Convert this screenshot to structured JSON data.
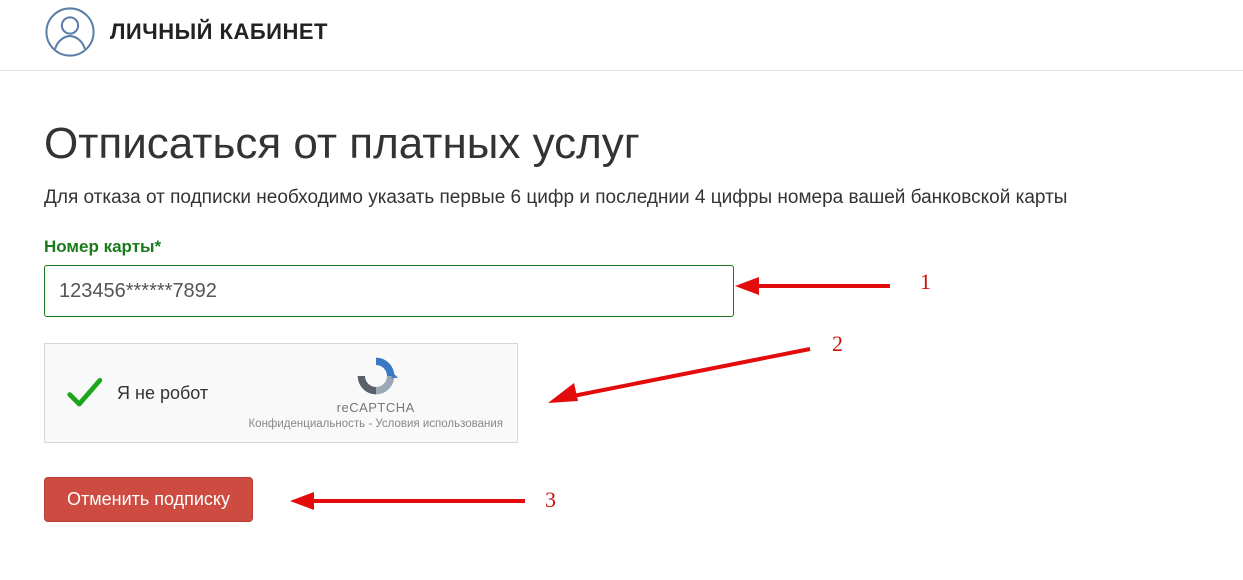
{
  "header": {
    "title": "ЛИЧНЫЙ КАБИНЕТ"
  },
  "page": {
    "heading": "Отписаться от платных услуг",
    "lead": "Для отказа от подписки необходимо указать первые 6 цифр и последнии 4 цифры номера вашей банковской карты"
  },
  "form": {
    "card_label": "Номер карты*",
    "card_value": "123456******7892",
    "captcha_label": "Я не робот",
    "captcha_brand": "reCAPTCHA",
    "captcha_privacy": "Конфиденциальность",
    "captcha_sep": " - ",
    "captcha_terms": "Условия использования",
    "submit_label": "Отменить подписку"
  },
  "annotations": {
    "n1": "1",
    "n2": "2",
    "n3": "3"
  }
}
